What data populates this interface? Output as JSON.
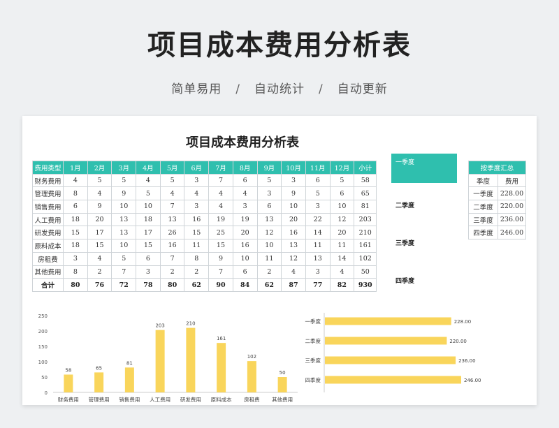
{
  "hero": {
    "title": "项目成本费用分析表",
    "tags": [
      "简单易用",
      "自动统计",
      "自动更新"
    ],
    "separator": "/"
  },
  "sheet": {
    "title": "项目成本费用分析表",
    "table": {
      "headers": [
        "费用类型",
        "1月",
        "2月",
        "3月",
        "4月",
        "5月",
        "6月",
        "7月",
        "8月",
        "9月",
        "10月",
        "11月",
        "12月",
        "小计"
      ],
      "rows": [
        [
          "财务费用",
          "4",
          "5",
          "5",
          "4",
          "5",
          "3",
          "7",
          "6",
          "5",
          "3",
          "6",
          "5",
          "58"
        ],
        [
          "管理费用",
          "8",
          "4",
          "9",
          "5",
          "4",
          "4",
          "4",
          "4",
          "3",
          "9",
          "5",
          "6",
          "65"
        ],
        [
          "销售费用",
          "6",
          "9",
          "10",
          "10",
          "7",
          "3",
          "4",
          "3",
          "6",
          "10",
          "3",
          "10",
          "81"
        ],
        [
          "人工费用",
          "18",
          "20",
          "13",
          "18",
          "13",
          "16",
          "19",
          "19",
          "13",
          "20",
          "22",
          "12",
          "203"
        ],
        [
          "研发费用",
          "15",
          "17",
          "13",
          "17",
          "26",
          "15",
          "25",
          "20",
          "12",
          "16",
          "14",
          "20",
          "210"
        ],
        [
          "原料成本",
          "18",
          "15",
          "10",
          "15",
          "16",
          "11",
          "15",
          "16",
          "10",
          "13",
          "11",
          "11",
          "161"
        ],
        [
          "房租费",
          "3",
          "4",
          "5",
          "6",
          "7",
          "8",
          "9",
          "10",
          "11",
          "12",
          "13",
          "14",
          "102"
        ],
        [
          "其他费用",
          "8",
          "2",
          "7",
          "3",
          "2",
          "2",
          "7",
          "6",
          "2",
          "4",
          "3",
          "4",
          "50"
        ]
      ],
      "total": [
        "合计",
        "80",
        "76",
        "72",
        "78",
        "80",
        "62",
        "90",
        "84",
        "62",
        "87",
        "77",
        "82",
        "930"
      ]
    },
    "quarter_selector": [
      "一季度",
      "二季度",
      "三季度",
      "四季度"
    ],
    "summary": {
      "title": "按季度汇总",
      "headers": [
        "季度",
        "费用"
      ],
      "rows": [
        [
          "一季度",
          "228.00"
        ],
        [
          "二季度",
          "220.00"
        ],
        [
          "三季度",
          "236.00"
        ],
        [
          "四季度",
          "246.00"
        ]
      ]
    }
  },
  "colors": {
    "accent": "#2fbfae",
    "bar": "#f9d55b"
  },
  "chart_data": [
    {
      "type": "bar",
      "categories": [
        "财务费用",
        "管理费用",
        "销售费用",
        "人工费用",
        "研发费用",
        "原料成本",
        "房租费",
        "其他费用"
      ],
      "values": [
        58,
        65,
        81,
        203,
        210,
        161,
        102,
        50
      ],
      "yticks": [
        0,
        50,
        100,
        150,
        200,
        250
      ],
      "ylim": [
        0,
        250
      ],
      "title": "",
      "xlabel": "",
      "ylabel": ""
    },
    {
      "type": "bar",
      "orientation": "horizontal",
      "categories": [
        "一季度",
        "二季度",
        "三季度",
        "四季度"
      ],
      "values": [
        228,
        220,
        236,
        246
      ],
      "value_labels": [
        "228.00",
        "220.00",
        "236.00",
        "246.00"
      ],
      "title": "",
      "xlabel": "",
      "ylabel": ""
    }
  ]
}
